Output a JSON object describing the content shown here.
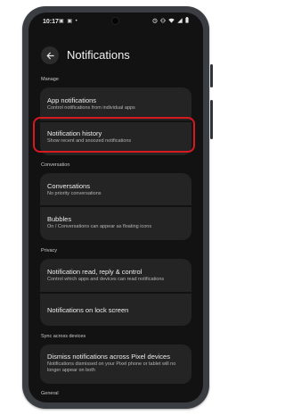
{
  "statusbar": {
    "time": "10:17",
    "left_icons": "▣ ▣ •"
  },
  "header": {
    "title": "Notifications"
  },
  "sections": [
    {
      "label": "Manage"
    },
    {
      "label": "Conversation"
    },
    {
      "label": "Privacy"
    },
    {
      "label": "Sync across devices"
    },
    {
      "label": "General"
    }
  ],
  "items": [
    {
      "title": "App notifications",
      "subtitle": "Control notifications from individual apps"
    },
    {
      "title": "Notification history",
      "subtitle": "Show recent and snoozed notifications"
    },
    {
      "title": "Conversations",
      "subtitle": "No priority conversations"
    },
    {
      "title": "Bubbles",
      "subtitle": "On / Conversations can appear as floating icons"
    },
    {
      "title": "Notification read, reply & control",
      "subtitle": "Control which apps and devices can read notifications"
    },
    {
      "title": "Notifications on lock screen",
      "subtitle": ""
    },
    {
      "title": "Dismiss notifications across Pixel devices",
      "subtitle": "Notifications dismissed on your Pixel phone or tablet will no longer appear on both"
    }
  ],
  "icons": {
    "back": "arrow-back-icon",
    "wifi": "wifi-icon",
    "signal": "signal-icon",
    "battery": "battery-icon",
    "mute": "vibrate-icon",
    "alarm": "alarm-icon"
  },
  "colors": {
    "highlight": "#d71920",
    "background": "#121212",
    "card": "#242424"
  }
}
